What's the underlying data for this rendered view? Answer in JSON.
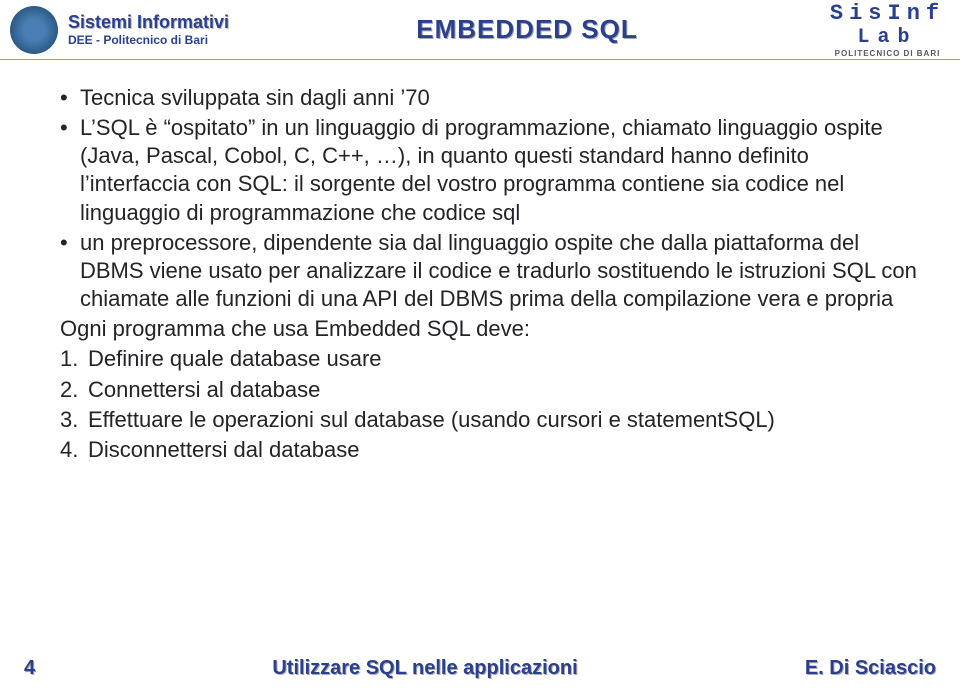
{
  "header": {
    "left_line1": "Sistemi Informativi",
    "left_line2": "DEE - Politecnico di Bari",
    "title": "EMBEDDED SQL",
    "right_si": "SisInf",
    "right_lab": "Lab",
    "right_sub": "POLITECNICO DI BARI"
  },
  "bullets": [
    "Tecnica sviluppata sin dagli anni ’70",
    "L’SQL è “ospitato” in un linguaggio di programmazione, chiamato linguaggio ospite (Java, Pascal, Cobol, C, C++, …), in quanto questi standard hanno definito l’interfaccia con SQL: il sorgente del vostro programma contiene sia codice nel linguaggio di programmazione che codice sql",
    "un preprocessore, dipendente sia dal linguaggio ospite che dalla piattaforma del DBMS viene usato per analizzare il codice e tradurlo sostituendo le istruzioni SQL con chiamate alle funzioni di una API del DBMS prima della compilazione vera e propria"
  ],
  "intro_line": "Ogni programma che usa Embedded SQL deve:",
  "ordered": [
    "Definire quale database usare",
    "Connettersi al database",
    "Effettuare le operazioni sul database (usando cursori e statementSQL)",
    "Disconnettersi dal database"
  ],
  "footer": {
    "page": "4",
    "title": "Utilizzare SQL nelle applicazioni",
    "author": "E. Di Sciascio"
  }
}
